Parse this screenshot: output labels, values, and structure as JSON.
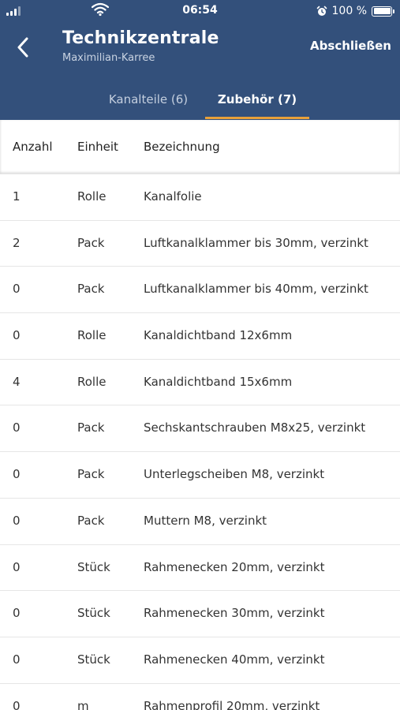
{
  "status_bar": {
    "time": "06:54",
    "battery_label": "100 %"
  },
  "header": {
    "title": "Technikzentrale",
    "subtitle": "Maximilian-Karree",
    "action_label": "Abschließen",
    "tabs": [
      {
        "label": "Kanalteile (6)",
        "selected": false
      },
      {
        "label": "Zubehör (7)",
        "selected": true
      }
    ]
  },
  "colors": {
    "header_bg": "#33507b",
    "tab_indicator": "#e8a13a"
  },
  "table": {
    "columns": [
      "Anzahl",
      "Einheit",
      "Bezeichnung"
    ],
    "rows": [
      {
        "qty": "1",
        "unit": "Rolle",
        "name": "Kanalfolie"
      },
      {
        "qty": "2",
        "unit": "Pack",
        "name": "Luftkanalklammer bis 30mm, verzinkt"
      },
      {
        "qty": "0",
        "unit": "Pack",
        "name": "Luftkanalklammer bis 40mm, verzinkt"
      },
      {
        "qty": "0",
        "unit": "Rolle",
        "name": "Kanaldichtband 12x6mm"
      },
      {
        "qty": "4",
        "unit": "Rolle",
        "name": "Kanaldichtband 15x6mm"
      },
      {
        "qty": "0",
        "unit": "Pack",
        "name": "Sechskantschrauben M8x25, verzinkt"
      },
      {
        "qty": "0",
        "unit": "Pack",
        "name": "Unterlegscheiben M8, verzinkt"
      },
      {
        "qty": "0",
        "unit": "Pack",
        "name": "Muttern M8, verzinkt"
      },
      {
        "qty": "0",
        "unit": "Stück",
        "name": "Rahmenecken 20mm, verzinkt"
      },
      {
        "qty": "0",
        "unit": "Stück",
        "name": "Rahmenecken 30mm, verzinkt"
      },
      {
        "qty": "0",
        "unit": "Stück",
        "name": "Rahmenecken 40mm, verzinkt"
      },
      {
        "qty": "0",
        "unit": "m",
        "name": "Rahmenprofil 20mm, verzinkt"
      }
    ]
  }
}
